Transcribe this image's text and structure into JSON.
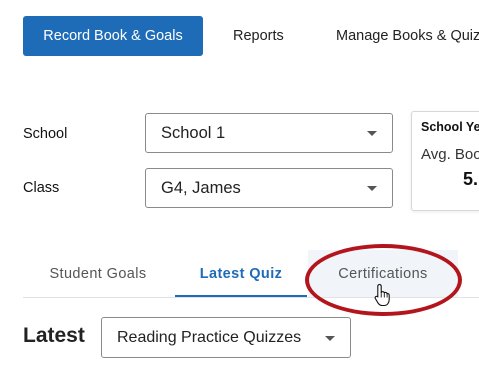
{
  "nav": {
    "primary": "Record Book & Goals",
    "reports": "Reports",
    "manage": "Manage Books & Quizz"
  },
  "filters": {
    "school_label": "School",
    "school_value": "School 1",
    "class_label": "Class",
    "class_value": "G4, James"
  },
  "stats_card": {
    "title": "School Ye",
    "subtitle": "Avg. Boo",
    "value": "5."
  },
  "tabs": [
    {
      "label": "Student Goals",
      "selected": false
    },
    {
      "label": "Latest Quiz",
      "selected": true
    },
    {
      "label": "Certifications",
      "selected": false
    }
  ],
  "latest": {
    "label": "Latest",
    "quiz_type": "Reading Practice Quizzes"
  },
  "colors": {
    "accent": "#1e6bb8",
    "highlight": "#b3151d"
  },
  "icons": {
    "caret": "chevron-down-icon",
    "cursor": "hand-pointer-icon"
  }
}
